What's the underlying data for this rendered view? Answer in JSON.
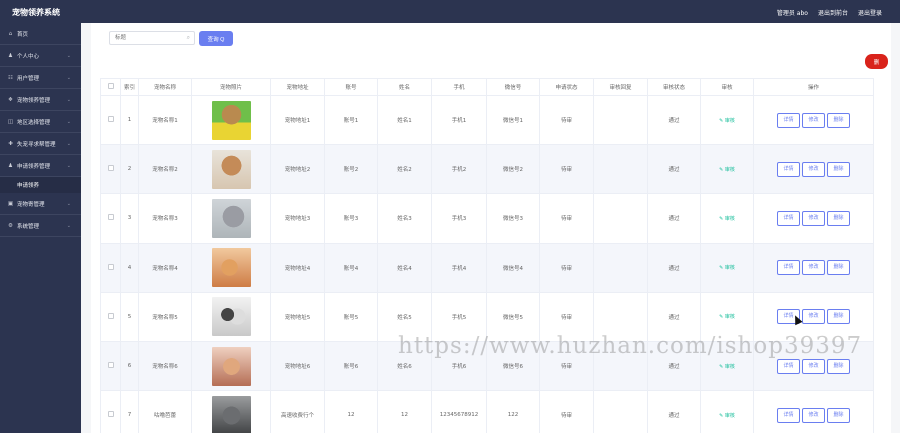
{
  "header": {
    "app_title": "宠物领养系统",
    "user_label": "管理员 abo",
    "backend_link": "退出到前台",
    "logout_link": "退出登录"
  },
  "sidebar": {
    "items": [
      {
        "label": "首页",
        "icon": "home-icon",
        "has_chevron": false
      },
      {
        "label": "个人中心",
        "icon": "user-icon",
        "has_chevron": true
      },
      {
        "label": "用户管理",
        "icon": "users-icon",
        "has_chevron": true
      },
      {
        "label": "宠物领养管理",
        "icon": "paw-icon",
        "has_chevron": true
      },
      {
        "label": "地区选择管理",
        "icon": "map-icon",
        "has_chevron": true
      },
      {
        "label": "失宠寻求帮管理",
        "icon": "help-icon",
        "has_chevron": true
      },
      {
        "label": "申请领养管理",
        "icon": "apply-icon",
        "has_chevron": true,
        "sub": "申请领养"
      },
      {
        "label": "宠物寄管理",
        "icon": "box-icon",
        "has_chevron": true
      },
      {
        "label": "系统管理",
        "icon": "gear-icon",
        "has_chevron": true
      }
    ]
  },
  "search": {
    "placeholder": "标题",
    "button_label": "查询 Q"
  },
  "delete_button": "删",
  "table": {
    "headers": [
      "",
      "索引",
      "宠物名称",
      "宠物照片",
      "宠物地址",
      "账号",
      "姓名",
      "手机",
      "微信号",
      "申请状态",
      "审核回复",
      "审核状态",
      "审核",
      "操作"
    ],
    "rows": [
      {
        "index": "1",
        "name": "宠物名称1",
        "addr": "宠物地址1",
        "account": "账号1",
        "realname": "姓名1",
        "phone": "手机1",
        "wechat": "微信号1",
        "apply": "待审",
        "reply": "",
        "status": "通过"
      },
      {
        "index": "2",
        "name": "宠物名称2",
        "addr": "宠物地址2",
        "account": "账号2",
        "realname": "姓名2",
        "phone": "手机2",
        "wechat": "微信号2",
        "apply": "待审",
        "reply": "",
        "status": "通过"
      },
      {
        "index": "3",
        "name": "宠物名称3",
        "addr": "宠物地址3",
        "account": "账号3",
        "realname": "姓名3",
        "phone": "手机3",
        "wechat": "微信号3",
        "apply": "待审",
        "reply": "",
        "status": "通过"
      },
      {
        "index": "4",
        "name": "宠物名称4",
        "addr": "宠物地址4",
        "account": "账号4",
        "realname": "姓名4",
        "phone": "手机4",
        "wechat": "微信号4",
        "apply": "待审",
        "reply": "",
        "status": "通过"
      },
      {
        "index": "5",
        "name": "宠物名称5",
        "addr": "宠物地址5",
        "account": "账号5",
        "realname": "姓名5",
        "phone": "手机5",
        "wechat": "微信号5",
        "apply": "待审",
        "reply": "",
        "status": "通过"
      },
      {
        "index": "6",
        "name": "宠物名称6",
        "addr": "宠物地址6",
        "account": "账号6",
        "realname": "姓名6",
        "phone": "手机6",
        "wechat": "微信号6",
        "apply": "待审",
        "reply": "",
        "status": "通过"
      },
      {
        "index": "7",
        "name": "咕噜芭蕾",
        "addr": "高速收费行个",
        "account": "12",
        "realname": "12",
        "phone": "12345678912",
        "wechat": "122",
        "apply": "待审",
        "reply": "",
        "status": "通过"
      }
    ],
    "audit_label": "审核",
    "op_detail": "详情",
    "op_edit": "修改",
    "op_delete": "删除"
  },
  "watermark": "https://www.huzhan.com/ishop39397",
  "colors": {
    "sidebar_bg": "#2c3450",
    "accent": "#6a7ef0",
    "danger": "#d9231b",
    "audit_green": "#19be9b"
  }
}
